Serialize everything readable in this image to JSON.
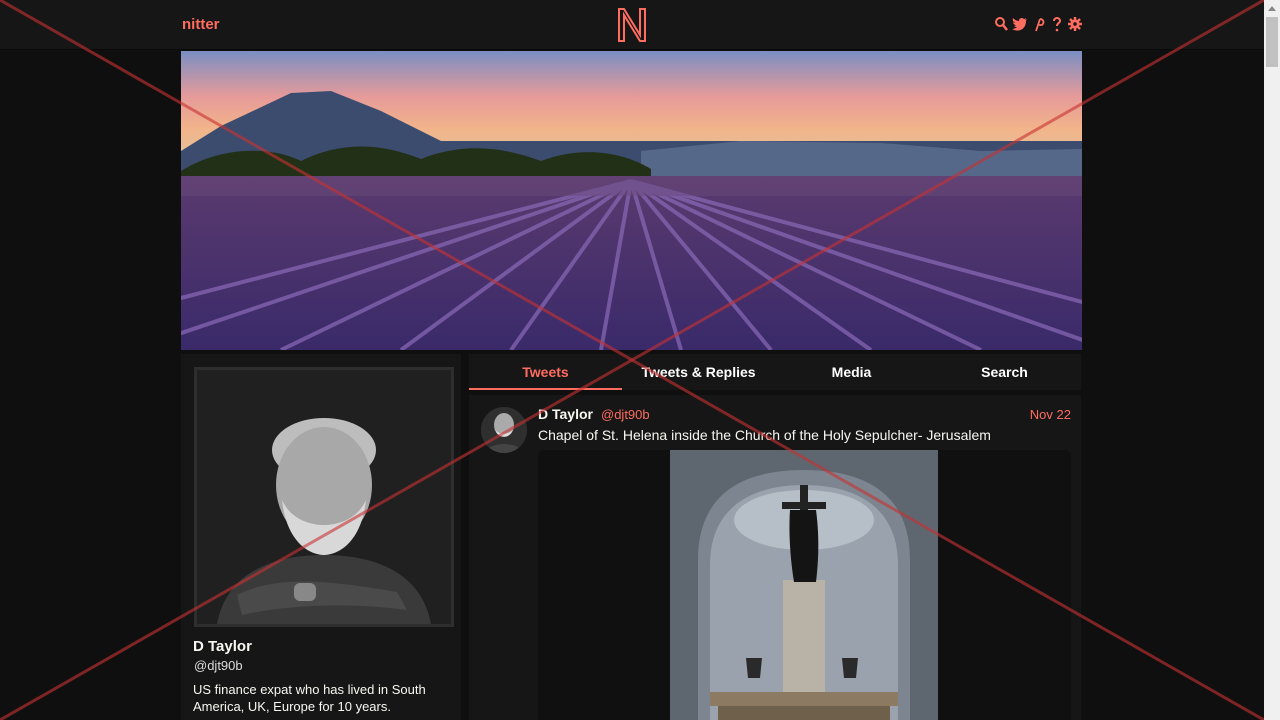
{
  "nav": {
    "brand": "nitter",
    "icons": [
      "search-icon",
      "twitter-icon",
      "rss-icon",
      "help-icon",
      "settings-icon"
    ],
    "accent": "#ff6c60"
  },
  "profile": {
    "fullname": "D Taylor",
    "username": "@djt90b",
    "bio": "US finance expat who has lived in South America, UK, Europe for 10 years."
  },
  "tabs": [
    {
      "label": "Tweets",
      "active": true
    },
    {
      "label": "Tweets & Replies",
      "active": false
    },
    {
      "label": "Media",
      "active": false
    },
    {
      "label": "Search",
      "active": false
    }
  ],
  "tweet": {
    "name": "D Taylor",
    "handle": "@djt90b",
    "date": "Nov 22",
    "text": "Chapel of St. Helena inside the Church of the Holy Sepulcher- Jerusalem"
  }
}
